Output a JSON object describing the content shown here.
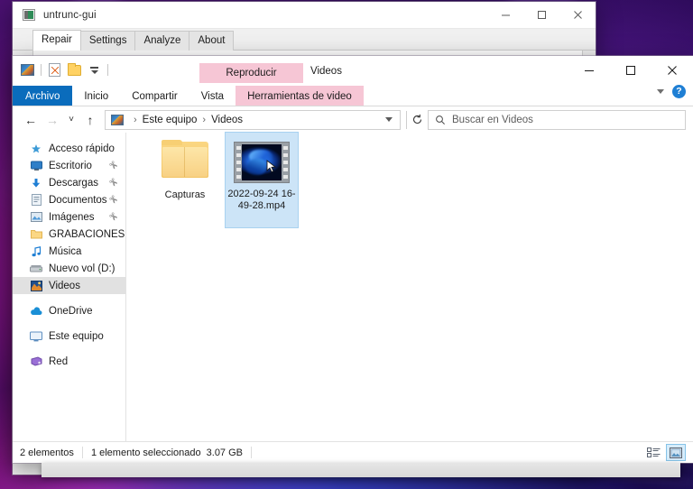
{
  "desktop": {
    "wallpaper_colors": [
      "#4a1070",
      "#2e0a58",
      "#20064a",
      "#ff28c8",
      "#465aff"
    ]
  },
  "untrunc_window": {
    "title": "untrunc-gui",
    "icon": "app-icon",
    "controls": {
      "minimize": "─",
      "maximize": "□",
      "close": "✕"
    },
    "tabs": [
      {
        "label": "Repair",
        "active": true
      },
      {
        "label": "Settings",
        "active": false
      },
      {
        "label": "Analyze",
        "active": false
      },
      {
        "label": "About",
        "active": false
      }
    ]
  },
  "explorer": {
    "quick_access_toolbar": {
      "icons": [
        "explorer-app-icon",
        "properties-icon",
        "new-folder-icon",
        "customize-caret-icon"
      ]
    },
    "contextual_tab_group": "Reproducir",
    "window_title": "Videos",
    "controls": {
      "minimize": "─",
      "maximize": "□",
      "close": "✕"
    },
    "ribbon_collapse": "chevron-down-icon",
    "help_label": "?",
    "ribbon_tabs": [
      {
        "label": "Archivo",
        "style": "file"
      },
      {
        "label": "Inicio",
        "style": "normal"
      },
      {
        "label": "Compartir",
        "style": "normal"
      },
      {
        "label": "Vista",
        "style": "normal"
      },
      {
        "label": "Herramientas de video",
        "style": "contextual"
      }
    ],
    "address_bar": {
      "back": "←",
      "forward": "→",
      "recent": "˅",
      "up": "↑",
      "crumbs": [
        "Este equipo",
        "Videos"
      ],
      "separator": "›",
      "refresh": "↻"
    },
    "search": {
      "placeholder": "Buscar en Videos",
      "icon": "search-icon"
    },
    "sidebar": {
      "items": [
        {
          "label": "Acceso rápido",
          "icon": "star-icon",
          "pinned": false,
          "selected": false,
          "group_start": false
        },
        {
          "label": "Escritorio",
          "icon": "desktop-icon",
          "pinned": true,
          "selected": false,
          "group_start": false
        },
        {
          "label": "Descargas",
          "icon": "download-icon",
          "pinned": true,
          "selected": false,
          "group_start": false
        },
        {
          "label": "Documentos",
          "icon": "document-icon",
          "pinned": true,
          "selected": false,
          "group_start": false
        },
        {
          "label": "Imágenes",
          "icon": "pictures-icon",
          "pinned": true,
          "selected": false,
          "group_start": false
        },
        {
          "label": "GRABACIONES",
          "icon": "folder-icon",
          "pinned": false,
          "selected": false,
          "group_start": false
        },
        {
          "label": "Música",
          "icon": "music-icon",
          "pinned": false,
          "selected": false,
          "group_start": false
        },
        {
          "label": "Nuevo vol (D:)",
          "icon": "drive-icon",
          "pinned": false,
          "selected": false,
          "group_start": false
        },
        {
          "label": "Videos",
          "icon": "videos-icon",
          "pinned": false,
          "selected": true,
          "group_start": false
        },
        {
          "label": "OneDrive",
          "icon": "cloud-icon",
          "pinned": false,
          "selected": false,
          "group_start": true
        },
        {
          "label": "Este equipo",
          "icon": "computer-icon",
          "pinned": false,
          "selected": false,
          "group_start": true
        },
        {
          "label": "Red",
          "icon": "network-icon",
          "pinned": false,
          "selected": false,
          "group_start": true
        }
      ],
      "pin_glyph": "✀"
    },
    "files": [
      {
        "name": "Capturas",
        "type": "folder",
        "selected": false
      },
      {
        "name": "2022-09-24 16-49-28.mp4",
        "type": "video",
        "selected": true
      }
    ],
    "status_bar": {
      "item_count": "2 elementos",
      "selection": "1 elemento seleccionado",
      "size": "3.07 GB",
      "views": [
        {
          "name": "details-view",
          "active": false
        },
        {
          "name": "large-icons-view",
          "active": true
        }
      ]
    }
  }
}
